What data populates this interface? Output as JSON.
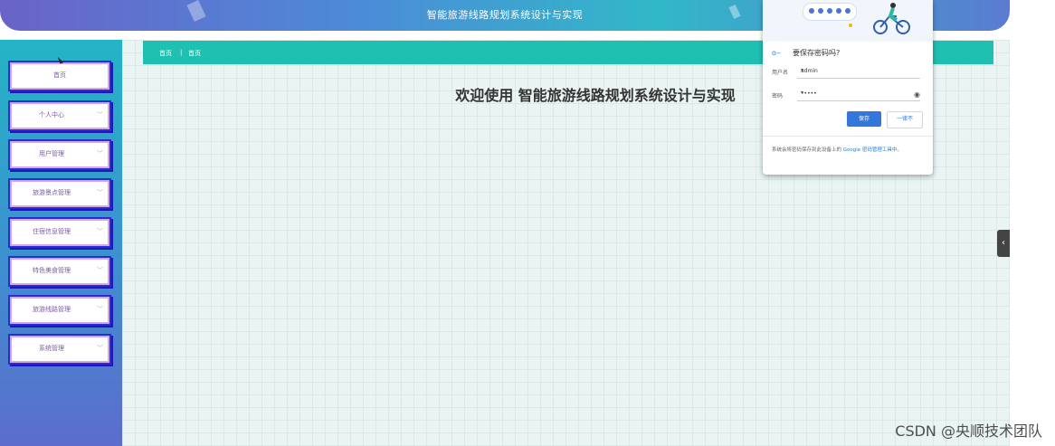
{
  "app": {
    "title": "智能旅游线路规划系统设计与实现"
  },
  "sidebar": {
    "items": [
      {
        "label": "首页"
      },
      {
        "label": "个人中心"
      },
      {
        "label": "用户管理"
      },
      {
        "label": "旅游景点管理"
      },
      {
        "label": "住宿信息管理"
      },
      {
        "label": "特色美食管理"
      },
      {
        "label": "旅游线路管理"
      },
      {
        "label": "系统管理"
      }
    ]
  },
  "breadcrumb": {
    "home": "首页",
    "separator": "|",
    "current": "首页"
  },
  "main": {
    "welcome": "欢迎使用 智能旅游线路规划系统设计与实现"
  },
  "password_popup": {
    "title": "要保存密码吗?",
    "username_label": "用户名",
    "username_value": "admin",
    "password_label": "密码",
    "password_value": "•••••",
    "save_label": "保存",
    "never_label": "一律不",
    "footer_text": "系统会将密码保存到此设备上的 ",
    "footer_link": "Google 密码管理工具",
    "footer_suffix": "中。"
  },
  "edge_tab_icon": "‹",
  "watermark": "CSDN @央顺技术团队",
  "colors": {
    "accent": "#1fc0b2",
    "menu_border": "#2a2bd8",
    "save_button": "#3277d9"
  }
}
